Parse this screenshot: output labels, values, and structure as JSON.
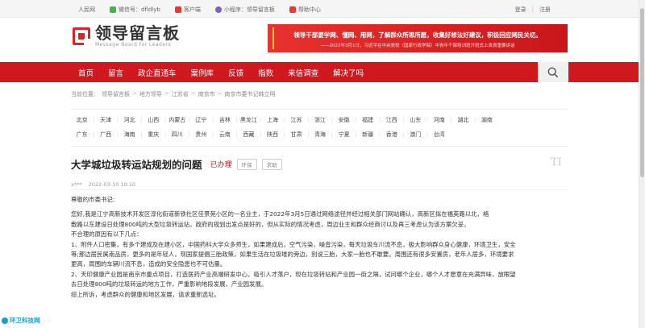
{
  "topbar": {
    "left": [
      {
        "label": "人民网",
        "icon": "none",
        "color": ""
      },
      {
        "label": "微信号：dfldlyb",
        "icon": "wechat-icon",
        "color": "#4caf50"
      },
      {
        "label": "客户端",
        "icon": "phone-icon",
        "color": "#e53935"
      },
      {
        "label": "小程序：领导留言板",
        "icon": "miniprogram-icon",
        "color": "#7b61c9"
      },
      {
        "label": "帮助中心",
        "icon": "help-icon",
        "color": "#e53935"
      }
    ],
    "login": "登录",
    "sep": "|",
    "register": "注册"
  },
  "logo": {
    "cn": "领导留言板",
    "en": "Message Board for Leaders"
  },
  "banner": {
    "line1": "领导干部要学网、懂网、用网，了解群众所思所愿，收集好想法好建议，积极回应网民关切。",
    "line2": "——2022年3月1日，习近平在中央党校（国家行政学院）中青年干部培训班开班式上发表重要讲话"
  },
  "nav": {
    "items": [
      "首页",
      "留言",
      "政企直通车",
      "案例库",
      "反馈",
      "指数",
      "来信调查",
      "解决了吗"
    ]
  },
  "breadcrumb": {
    "label": "当前位置：",
    "items": [
      "领导留言板",
      "地方领导",
      "江苏省",
      "南京市",
      "南京市委书记韩立明"
    ]
  },
  "regions": {
    "row1": [
      "北京",
      "天津",
      "河北",
      "山西",
      "内蒙古",
      "辽宁",
      "吉林",
      "黑龙江",
      "上海",
      "江苏",
      "浙江",
      "安徽",
      "福建",
      "江西",
      "山东",
      "河南",
      "湖北",
      "湖南"
    ],
    "row2": [
      "广东",
      "广西",
      "海南",
      "重庆",
      "四川",
      "贵州",
      "云南",
      "西藏",
      "陕西",
      "甘肃",
      "青海",
      "宁夏",
      "新疆",
      "香港",
      "澳门",
      "台湾"
    ]
  },
  "article": {
    "title": "大学城垃圾转运站规划的问题",
    "status": "已办理",
    "tag1": "环保",
    "tag2": "求助",
    "mark": "TI",
    "author": "x***",
    "time": "2022-03-10 10:10",
    "paragraphs": [
      "尊敬的市委书记:",
      "您好,我是江宁高新技术开发区淳化街道新铁社区佳景苑小区的一名业主，于2022年3月5日通过网络途径并经过相关部门网站确认，高新区拟在福英路以北，格",
      "敷路以东建设日处理800吨的大型垃圾转运站，政府的规划出发点是好的，但从实际的情况考虑，周边业主和群众经商讨以及再三考虑认为该方案欠妥。",
      "不合理的原因有以下几点：",
      "1、附件人口密集，有多个建成及在建小区，中国药科大学众多师生，如果建成后，空气污染，噪音污染，每天垃圾车川流不息，极大影响群众身心健康，环境卫生，安全",
      "等;那边居民属南品房，更多的是年轻人，现国家提倡三胎政策，如果生活在垃圾堆的旁边，别说三胎，大家一胎也不敢要。周围还有很多安置房，老年人居多，环境要求",
      "更高，周围的车辆川流不息，造成的安全隐患也不可估量。",
      "2、天印健康产业园是南京市重点项目，打造医药产业高端研发中心，吸引人才落户，现在垃圾转站和产业园一街之隔，试问哪个企业，哪个人才愿意在充满异味，放眼望",
      "去日处理800吨的垃圾转运的地方工作，严重影响地段发展，产业园发展。",
      "综上所诉，考虑群众的健康和地区发展，请求重新选址。"
    ]
  },
  "watermark": "环卫科技网",
  "colors": {
    "brand_red": "#d0191f",
    "status_red": "#d0191f"
  }
}
